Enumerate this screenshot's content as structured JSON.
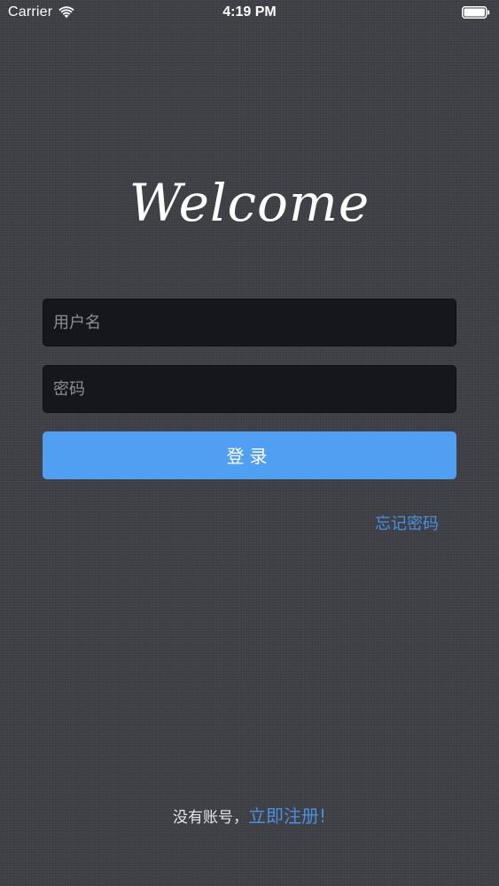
{
  "status_bar": {
    "carrier": "Carrier",
    "time": "4:19 PM",
    "wifi_icon": "wifi-icon",
    "battery_icon": "battery-icon"
  },
  "welcome": {
    "title": "Welcome"
  },
  "form": {
    "username_placeholder": "用户名",
    "username_value": "",
    "password_placeholder": "密码",
    "password_value": "",
    "login_label": "登录",
    "forgot_label": "忘记密码"
  },
  "footer": {
    "prompt": "没有账号，",
    "register_label": "立即注册!"
  },
  "colors": {
    "background": "#3f4147",
    "field_background": "#16171c",
    "accent": "#519ff2",
    "link": "#4a90e0"
  }
}
